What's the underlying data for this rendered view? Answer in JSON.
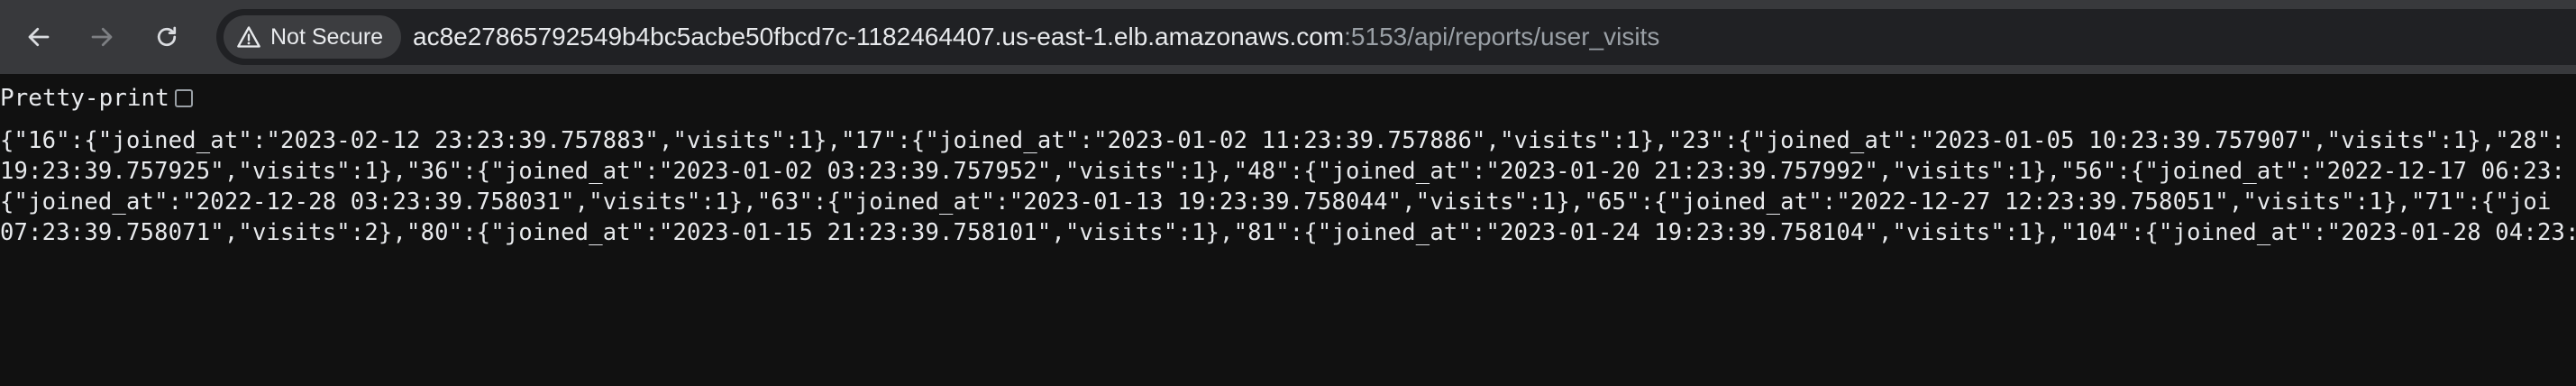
{
  "browser": {
    "security_label": "Not Secure",
    "url_host": "ac8e27865792549b4bc5acbe50fbcd7c-1182464407.us-east-1.elb.amazonaws.com",
    "url_path": ":5153/api/reports/user_visits"
  },
  "icons": {
    "back": "back-arrow-icon",
    "forward": "forward-arrow-icon",
    "reload": "reload-icon",
    "security": "warning-triangle-icon"
  },
  "viewer": {
    "pretty_print_label": "Pretty-print",
    "pretty_print_checked": false,
    "lines": [
      "{\"16\":{\"joined_at\":\"2023-02-12 23:23:39.757883\",\"visits\":1},\"17\":{\"joined_at\":\"2023-01-02 11:23:39.757886\",\"visits\":1},\"23\":{\"joined_at\":\"2023-01-05 10:23:39.757907\",\"visits\":1},\"28\":",
      "19:23:39.757925\",\"visits\":1},\"36\":{\"joined_at\":\"2023-01-02 03:23:39.757952\",\"visits\":1},\"48\":{\"joined_at\":\"2023-01-20 21:23:39.757992\",\"visits\":1},\"56\":{\"joined_at\":\"2022-12-17 06:23:",
      "{\"joined_at\":\"2022-12-28 03:23:39.758031\",\"visits\":1},\"63\":{\"joined_at\":\"2023-01-13 19:23:39.758044\",\"visits\":1},\"65\":{\"joined_at\":\"2022-12-27 12:23:39.758051\",\"visits\":1},\"71\":{\"joi",
      "07:23:39.758071\",\"visits\":2},\"80\":{\"joined_at\":\"2023-01-15 21:23:39.758101\",\"visits\":1},\"81\":{\"joined_at\":\"2023-01-24 19:23:39.758104\",\"visits\":1},\"104\":{\"joined_at\":\"2023-01-28 04:23:"
    ]
  },
  "colors": {
    "toolbar_bg": "#38393c",
    "omnibox_bg": "#202124",
    "page_bg": "#111111",
    "text": "#e8eaed",
    "muted_text": "#9aa0a6"
  }
}
